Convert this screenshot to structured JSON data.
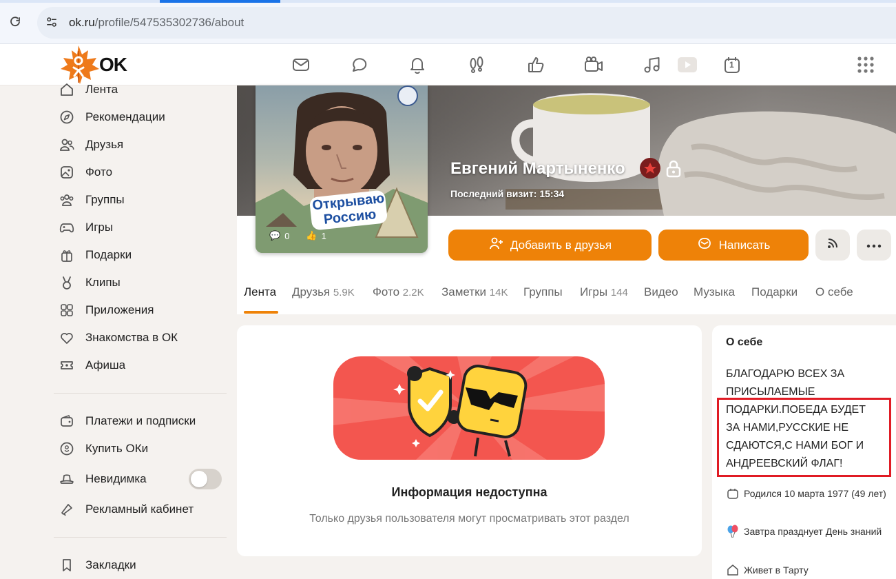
{
  "browser": {
    "url_domain": "ok.ru",
    "url_path": "/profile/547535302736/about"
  },
  "logo": {
    "text": "OK"
  },
  "top_nav": {
    "icons": [
      "mail-icon",
      "chat-icon",
      "bell-icon",
      "guests-icon",
      "likes-icon",
      "video-chat-icon",
      "music-icon",
      "video-icon",
      "calendar-icon"
    ],
    "apps_icon": "apps-grid-icon",
    "calendar_day": "1"
  },
  "sidebar": {
    "items": [
      "Лента",
      "Рекомендации",
      "Друзья",
      "Фото",
      "Группы",
      "Игры",
      "Подарки",
      "Клипы",
      "Приложения",
      "Знакомства в ОК",
      "Афиша"
    ],
    "items2": [
      "Платежи и подписки",
      "Купить ОКи",
      "Невидимка",
      "Рекламный кабинет"
    ],
    "items3": [
      "Закладки"
    ]
  },
  "profile": {
    "name": "Евгений Мартыненко",
    "last_visit": "Последний визит: 15:34",
    "avatar_badge": "Открываю Россию",
    "avatar_comments": "0",
    "avatar_likes": "1",
    "add_friend": "Добавить в друзья",
    "write": "Написать"
  },
  "tabs": [
    {
      "label": "Лента",
      "count": ""
    },
    {
      "label": "Друзья",
      "count": "5.9K"
    },
    {
      "label": "Фото",
      "count": "2.2K"
    },
    {
      "label": "Заметки",
      "count": "14K"
    },
    {
      "label": "Группы",
      "count": ""
    },
    {
      "label": "Игры",
      "count": "144"
    },
    {
      "label": "Видео",
      "count": ""
    },
    {
      "label": "Музыка",
      "count": ""
    },
    {
      "label": "Подарки",
      "count": ""
    },
    {
      "label": "О себе",
      "count": ""
    }
  ],
  "content": {
    "title": "Информация недоступна",
    "text": "Только друзья пользователя могут просматривать этот раздел"
  },
  "about": {
    "title": "О себе",
    "lines": [
      "БЛАГОДАРЮ ВСЕХ ЗА",
      "ПРИСЫЛАЕМЫЕ",
      "ПОДАРКИ.ПОБЕДА БУДЕТ",
      "ЗА НАМИ,РУССКИЕ НЕ",
      "СДАЮТСЯ,С НАМИ БОГ И",
      "АНДРЕЕВСКИЙ ФЛАГ!"
    ],
    "birthday": "Родился 10 марта 1977 (49 лет)",
    "holiday": "Завтра празднует День знаний",
    "lives": "Живет в Тарту"
  },
  "colors": {
    "accent": "#ee8208",
    "highlight": "#e01b24"
  }
}
